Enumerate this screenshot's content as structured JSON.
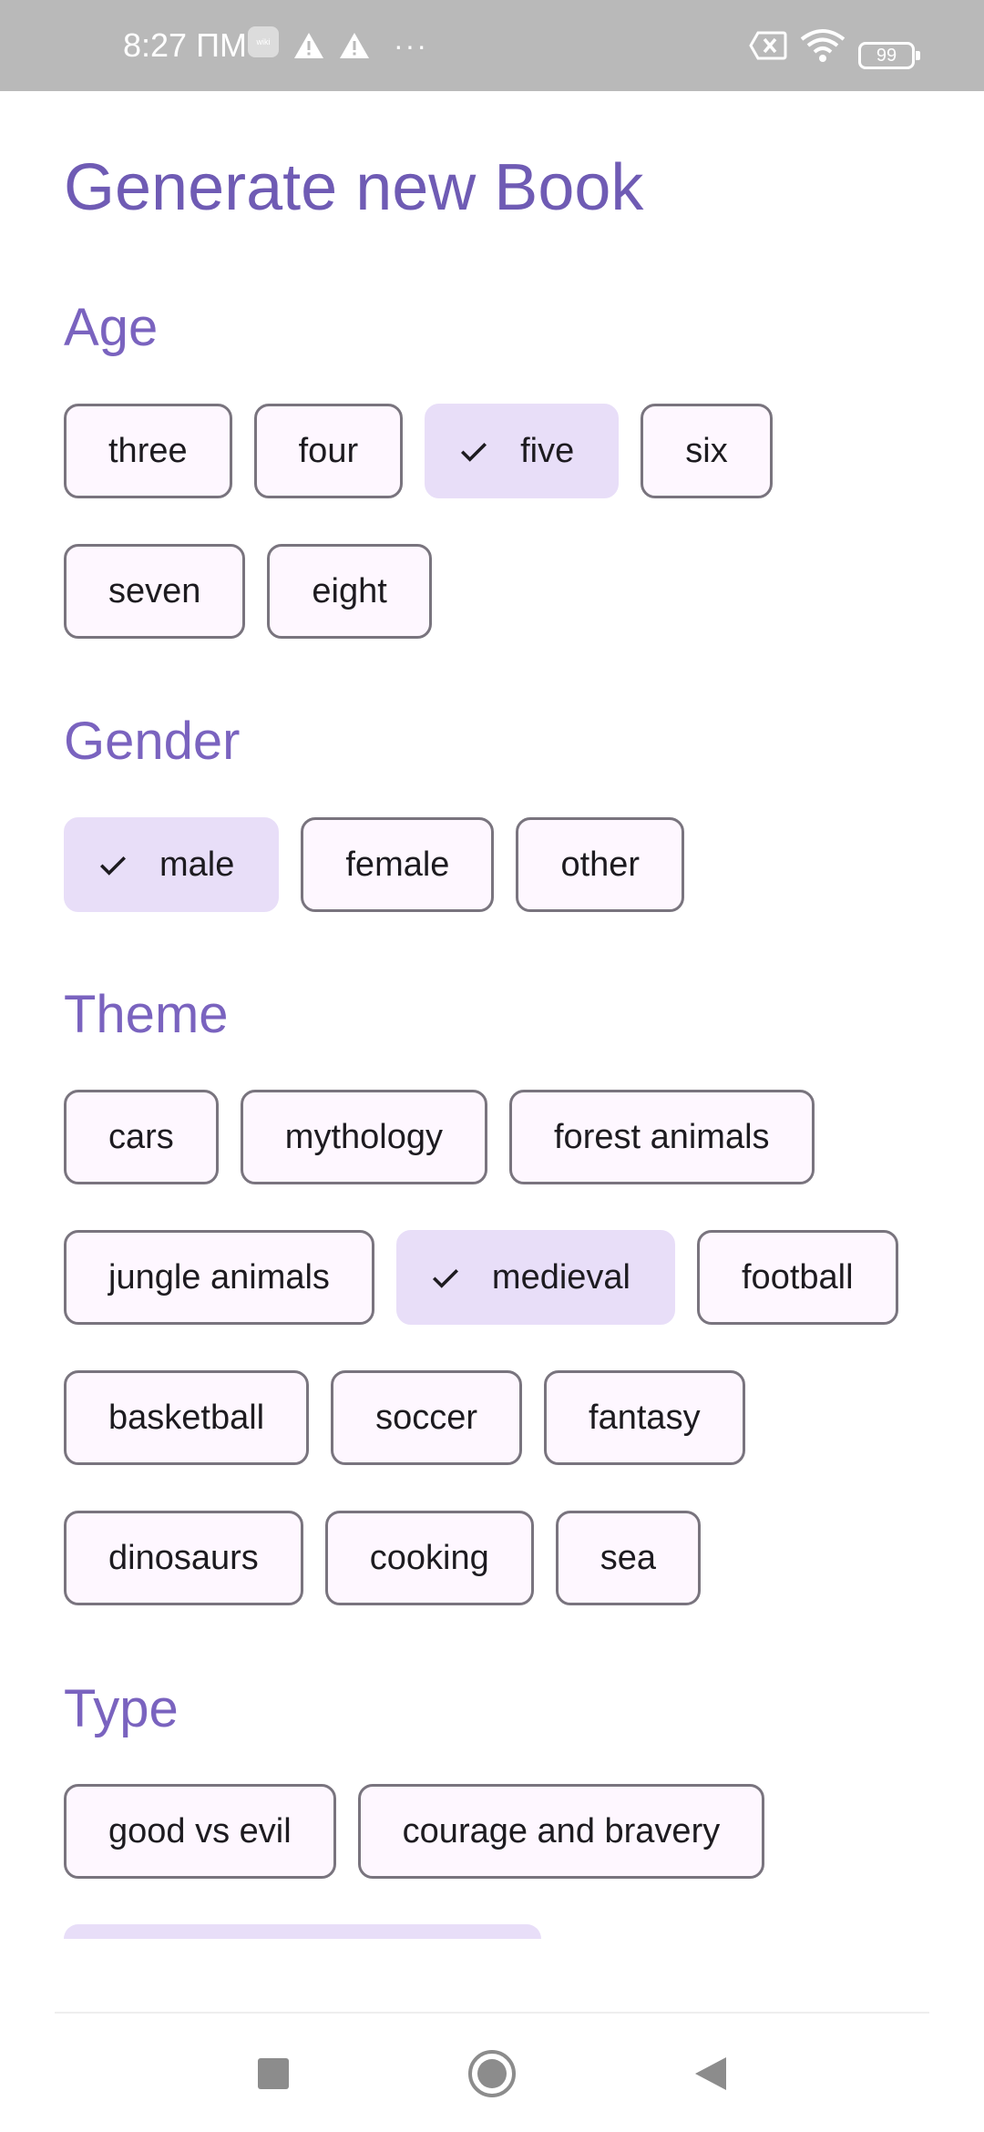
{
  "status_bar": {
    "time": "8:27 ПМ",
    "vk_badge": "wiki",
    "dots": "···",
    "battery": "99",
    "icons": [
      "vk-icon",
      "warning-icon",
      "warning-icon",
      "more-icon",
      "sim-off-icon",
      "wifi-icon",
      "battery-icon"
    ]
  },
  "page": {
    "title": "Generate new Book"
  },
  "sections": {
    "age": {
      "title": "Age",
      "row1": [
        "three",
        "four",
        "five",
        "six"
      ],
      "row2": [
        "seven",
        "eight"
      ],
      "selected": "five"
    },
    "gender": {
      "title": "Gender",
      "row1": [
        "male",
        "female",
        "other"
      ],
      "selected": "male"
    },
    "theme": {
      "title": "Theme",
      "row1": [
        "cars",
        "mythology",
        "forest animals"
      ],
      "row2": [
        "jungle animals",
        "medieval",
        "football"
      ],
      "row3": [
        "basketball",
        "soccer",
        "fantasy"
      ],
      "row4": [
        "dinosaurs",
        "cooking",
        "sea"
      ],
      "selected": "medieval"
    },
    "type": {
      "title": "Type",
      "row1": [
        "good vs evil",
        "courage and bravery"
      ]
    }
  },
  "nav_bar": {
    "icons": [
      "recents-square-icon",
      "home-circle-icon",
      "back-triangle-icon"
    ]
  },
  "colors": {
    "accent": "#6f5bb4",
    "chip_selected_bg": "#e8def8",
    "chip_bg": "#fef7ff",
    "chip_border": "#79747e",
    "status_bar_bg": "#b9b9b9"
  }
}
